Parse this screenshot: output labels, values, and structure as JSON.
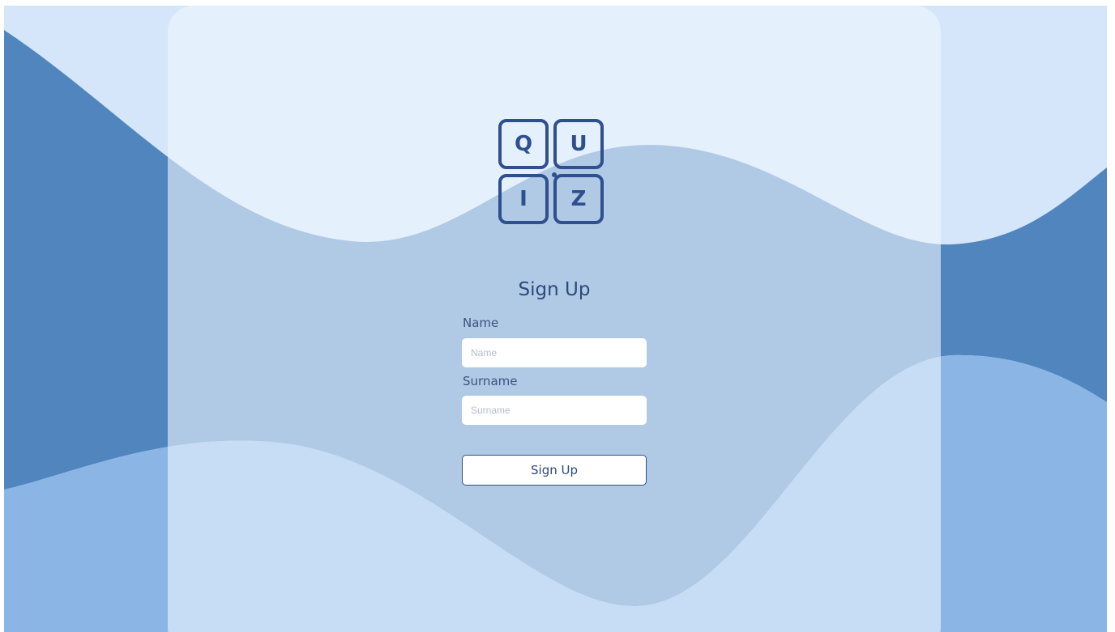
{
  "colors": {
    "background_top": "#d5e6fb",
    "wave_dark": "#5185bd",
    "wave_light": "#8bb5e5",
    "card": "#e8f0fd",
    "accent": "#2f4f8f"
  },
  "logo": {
    "icon": "quiz-logo-icon",
    "letters": [
      "Q",
      "U",
      "I",
      "Z"
    ]
  },
  "form": {
    "title": "Sign Up",
    "name": {
      "label": "Name",
      "placeholder": "Name",
      "value": ""
    },
    "surname": {
      "label": "Surname",
      "placeholder": "Surname",
      "value": ""
    },
    "submit_label": "Sign Up"
  }
}
